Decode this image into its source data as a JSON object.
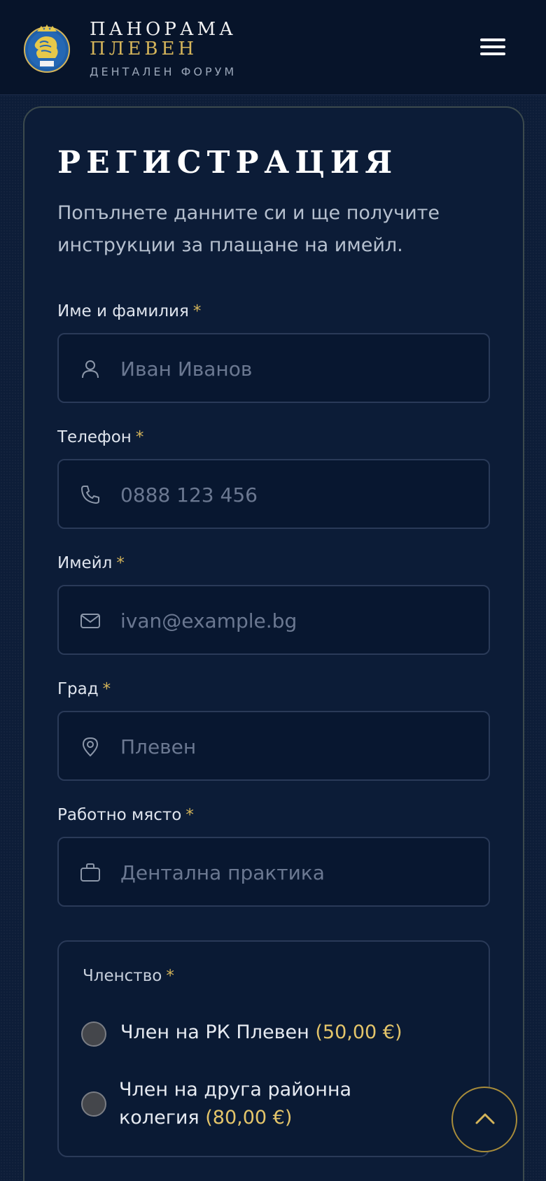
{
  "header": {
    "brand_line1": "ПАНОРАМА",
    "brand_line2": "ПЛЕВЕН",
    "brand_line3": "ДЕНТАЛЕН ФОРУМ",
    "logo_icon": "lion-crest-logo",
    "menu_icon": "hamburger-menu-icon"
  },
  "form": {
    "title": "РЕГИСТРАЦИЯ",
    "subtitle": "Попълнете данните си и ще получите инструкции за плащане на имейл.",
    "required_mark": "*",
    "fields": {
      "name": {
        "label": "Име и фамилия",
        "placeholder": "Иван Иванов",
        "icon": "user-icon"
      },
      "phone": {
        "label": "Телефон",
        "placeholder": "0888 123 456",
        "icon": "phone-icon"
      },
      "email": {
        "label": "Имейл",
        "placeholder": "ivan@example.bg",
        "icon": "mail-icon"
      },
      "city": {
        "label": "Град",
        "placeholder": "Плевен",
        "icon": "map-pin-icon"
      },
      "workplace": {
        "label": "Работно място",
        "placeholder": "Дентална практика",
        "icon": "briefcase-icon"
      }
    },
    "membership": {
      "label": "Членство",
      "options": [
        {
          "text": "Член на РК Плевен",
          "price": "(50,00 €)"
        },
        {
          "text": "Член на друга районна колегия",
          "price": "(80,00 €)"
        }
      ]
    }
  },
  "scroll_top": {
    "icon": "chevron-up-icon"
  },
  "colors": {
    "background": "#0d1d38",
    "header": "#07142a",
    "accent_gold": "#d4b45a",
    "input_bg": "#081730"
  }
}
